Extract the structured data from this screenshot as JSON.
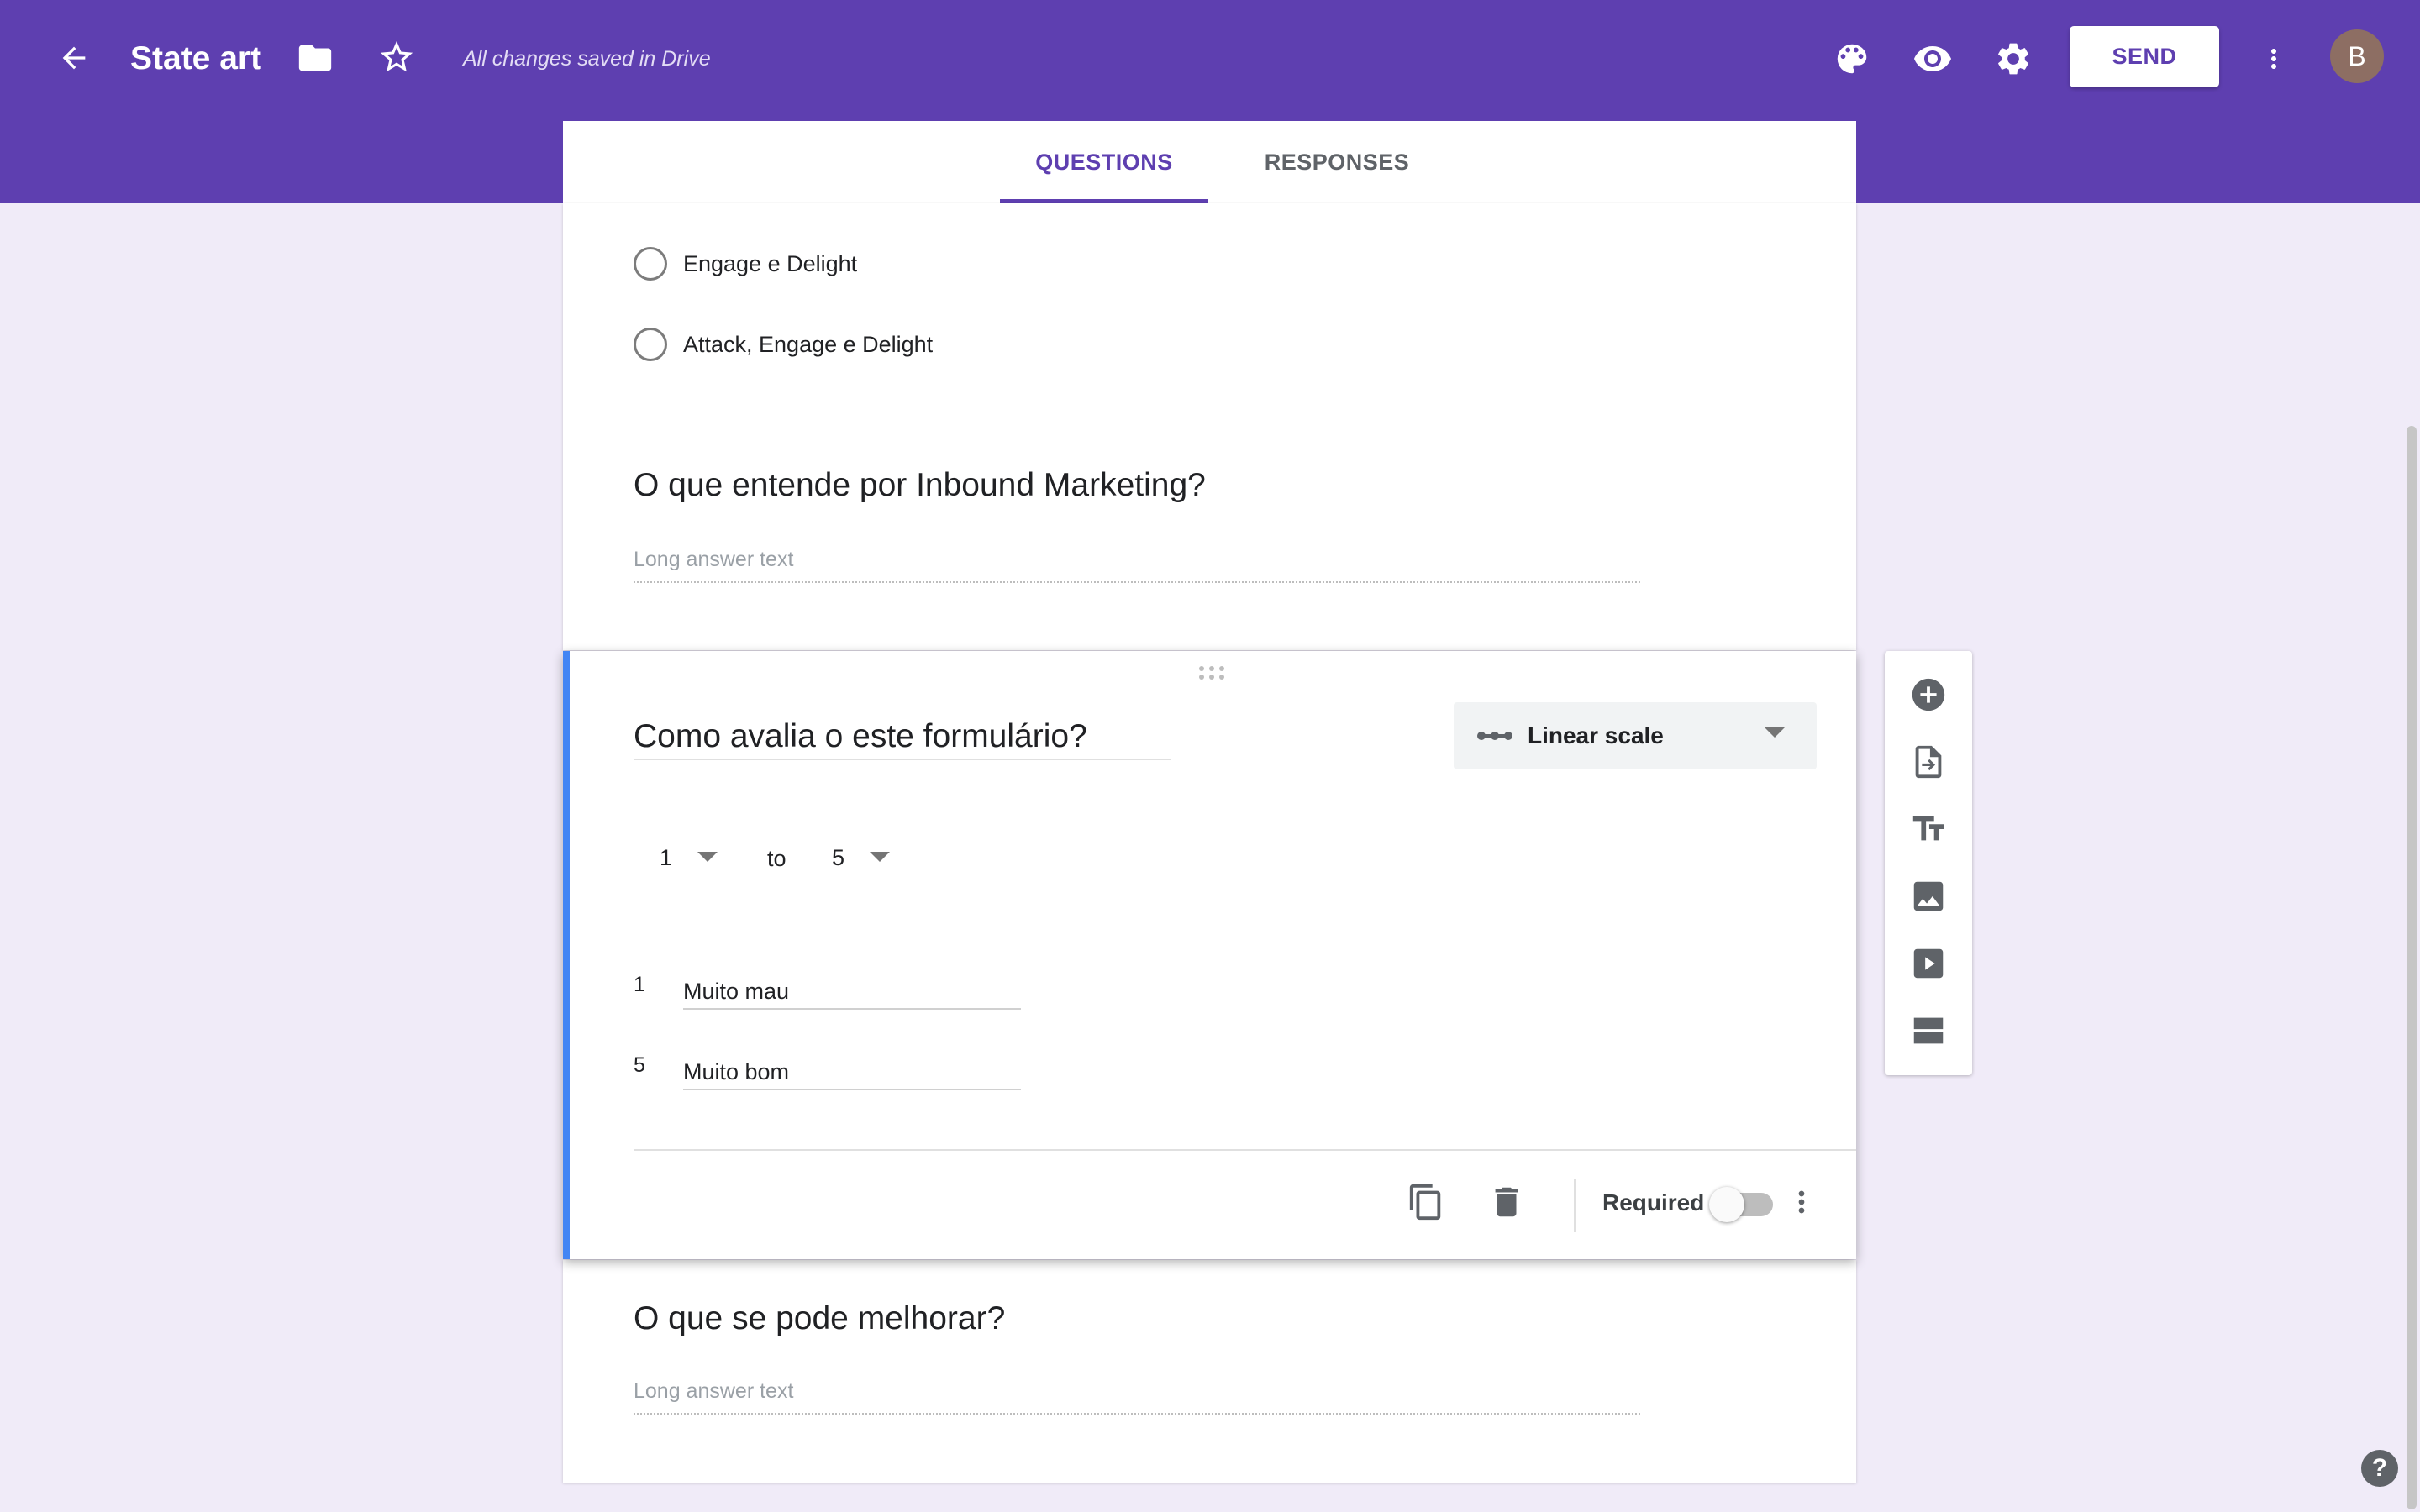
{
  "header": {
    "title": "State art",
    "save_status": "All changes saved in Drive",
    "send_label": "SEND",
    "avatar_initial": "B",
    "background": "#5e3fb0"
  },
  "tabs": [
    {
      "label": "QUESTIONS",
      "active": true
    },
    {
      "label": "RESPONSES",
      "active": false
    }
  ],
  "top_card": {
    "options": [
      "Engage e Delight",
      "Attack, Engage e Delight"
    ],
    "question": "O que entende por Inbound Marketing?",
    "placeholder": "Long answer text"
  },
  "active_card": {
    "question": "Como avalia o este formulário?",
    "type_label": "Linear scale",
    "range_from": "1",
    "range_to_word": "to",
    "range_to": "5",
    "labels": [
      {
        "num": "1",
        "text": "Muito mau"
      },
      {
        "num": "5",
        "text": "Muito bom"
      }
    ],
    "required_label": "Required",
    "required_on": false
  },
  "bottom_card": {
    "question": "O que se pode melhorar?",
    "placeholder": "Long answer text"
  },
  "help_label": "?",
  "colors": {
    "accent": "#5e3fb0",
    "active_stripe": "#4285f4",
    "page_background": "#f0ebf8"
  }
}
